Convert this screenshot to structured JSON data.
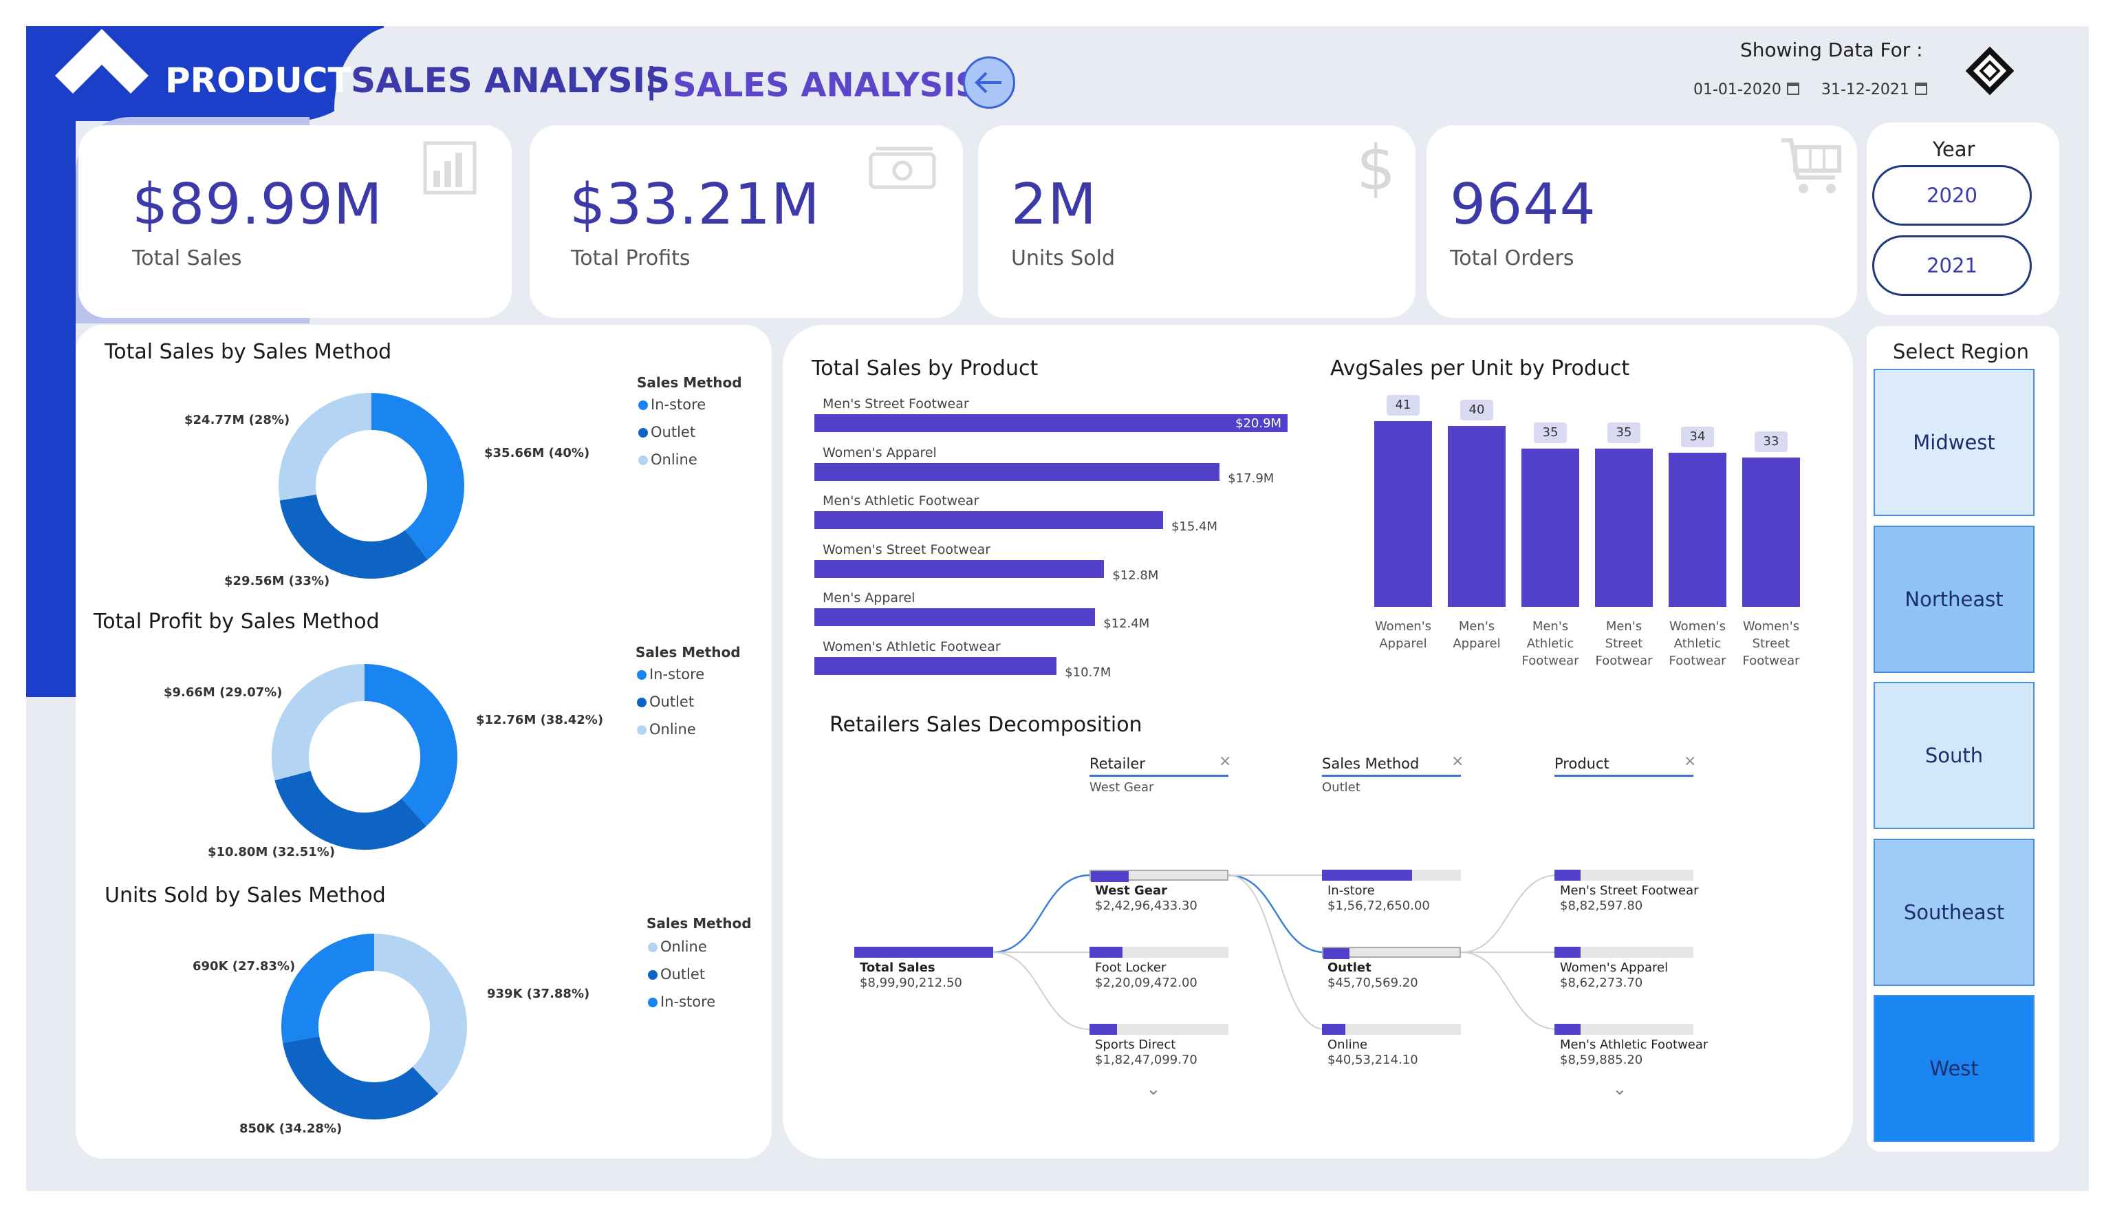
{
  "header": {
    "title_part1": "PRODUCT",
    "title_part2": "SALES ANALYSIS",
    "separator": "|",
    "subtitle": "SALES ANALYSIS",
    "showing_label": "Showing Data For :",
    "date_from": "01-01-2020",
    "date_to": "31-12-2021"
  },
  "kpis": [
    {
      "value": "$89.99M",
      "label": "Total Sales",
      "icon": "bar-chart-icon"
    },
    {
      "value": "$33.21M",
      "label": "Total Profits",
      "icon": "money-icon"
    },
    {
      "value": "2M",
      "label": "Units Sold",
      "icon": "dollar-icon"
    },
    {
      "value": "9644",
      "label": "Total Orders",
      "icon": "cart-icon"
    }
  ],
  "year_slicer": {
    "title": "Year",
    "options": [
      "2020",
      "2021"
    ]
  },
  "region_slicer": {
    "title": "Select Region",
    "regions": [
      {
        "name": "Midwest",
        "color": "#dcecfc"
      },
      {
        "name": "Northeast",
        "color": "#90c4f6"
      },
      {
        "name": "South",
        "color": "#d3e7fb"
      },
      {
        "name": "Southeast",
        "color": "#9fccf7"
      },
      {
        "name": "West",
        "color": "#1b86f2"
      }
    ]
  },
  "colors": {
    "in_store": "#1a85f0",
    "outlet": "#0e64c4",
    "online": "#b4d4f4",
    "bar": "#5340c9",
    "brand": "#1c3fc9"
  },
  "donut_sales": {
    "title": "Total Sales by Sales Method",
    "legend_title": "Sales Method",
    "legend": [
      "In-store",
      "Outlet",
      "Online"
    ],
    "labels": [
      "$35.66M (40%)",
      "$29.56M (33%)",
      "$24.77M (28%)"
    ]
  },
  "donut_profit": {
    "title": "Total Profit by Sales Method",
    "legend_title": "Sales Method",
    "legend": [
      "In-store",
      "Outlet",
      "Online"
    ],
    "labels": [
      "$12.76M (38.42%)",
      "$10.80M (32.51%)",
      "$9.66M (29.07%)"
    ]
  },
  "donut_units": {
    "title": "Units Sold by Sales Method",
    "legend_title": "Sales Method",
    "legend": [
      "Online",
      "Outlet",
      "In-store"
    ],
    "labels": [
      "939K (37.88%)",
      "850K (34.28%)",
      "690K (27.83%)"
    ]
  },
  "chart_data": [
    {
      "type": "pie",
      "title": "Total Sales by Sales Method",
      "categories": [
        "In-store",
        "Outlet",
        "Online"
      ],
      "values": [
        35.66,
        29.56,
        24.77
      ],
      "percent": [
        40,
        33,
        28
      ],
      "unit": "$M"
    },
    {
      "type": "pie",
      "title": "Total Profit by Sales Method",
      "categories": [
        "In-store",
        "Outlet",
        "Online"
      ],
      "values": [
        12.76,
        10.8,
        9.66
      ],
      "percent": [
        38.42,
        32.51,
        29.07
      ],
      "unit": "$M"
    },
    {
      "type": "pie",
      "title": "Units Sold by Sales Method",
      "categories": [
        "Online",
        "Outlet",
        "In-store"
      ],
      "values": [
        939,
        850,
        690
      ],
      "percent": [
        37.88,
        34.28,
        27.83
      ],
      "unit": "K"
    },
    {
      "type": "bar",
      "orientation": "horizontal",
      "title": "Total Sales by Product",
      "categories": [
        "Men's Street Footwear",
        "Women's Apparel",
        "Men's Athletic Footwear",
        "Women's Street Footwear",
        "Men's Apparel",
        "Women's Athletic Footwear"
      ],
      "values": [
        20.9,
        17.9,
        15.4,
        12.8,
        12.4,
        10.7
      ],
      "value_labels": [
        "$20.9M",
        "$17.9M",
        "$15.4M",
        "$12.8M",
        "$12.4M",
        "$10.7M"
      ],
      "unit": "$M"
    },
    {
      "type": "bar",
      "title": "AvgSales per Unit by Product",
      "categories": [
        "Women's Apparel",
        "Men's Apparel",
        "Men's Athletic Footwear",
        "Men's Street Footwear",
        "Women's Athletic Footwear",
        "Women's Street Footwear"
      ],
      "category_lines": [
        [
          "Women's",
          "Apparel"
        ],
        [
          "Men's",
          "Apparel"
        ],
        [
          "Men's",
          "Athletic",
          "Footwear"
        ],
        [
          "Men's",
          "Street",
          "Footwear"
        ],
        [
          "Women's",
          "Athletic",
          "Footwear"
        ],
        [
          "Women's",
          "Street",
          "Footwear"
        ]
      ],
      "values": [
        41,
        40,
        35,
        35,
        34,
        33
      ]
    }
  ],
  "decomposition": {
    "title": "Retailers Sales Decomposition",
    "headers": [
      {
        "name": "Retailer",
        "filter": "West Gear"
      },
      {
        "name": "Sales Method",
        "filter": "Outlet"
      },
      {
        "name": "Product",
        "filter": ""
      }
    ],
    "root": {
      "name": "Total Sales",
      "value": "$8,99,90,212.50",
      "fill": 1.0
    },
    "level1": [
      {
        "name": "West Gear",
        "value": "$2,42,96,433.30",
        "fill": 0.27,
        "selected": true
      },
      {
        "name": "Foot Locker",
        "value": "$2,20,09,472.00",
        "fill": 0.24
      },
      {
        "name": "Sports Direct",
        "value": "$1,82,47,099.70",
        "fill": 0.2
      }
    ],
    "level2": [
      {
        "name": "In-store",
        "value": "$1,56,72,650.00",
        "fill": 0.65
      },
      {
        "name": "Outlet",
        "value": "$45,70,569.20",
        "fill": 0.19,
        "selected": true
      },
      {
        "name": "Online",
        "value": "$40,53,214.10",
        "fill": 0.17
      }
    ],
    "level3": [
      {
        "name": "Men's Street Footwear",
        "value": "$8,82,597.80",
        "fill": 0.19
      },
      {
        "name": "Women's Apparel",
        "value": "$8,62,273.70",
        "fill": 0.19
      },
      {
        "name": "Men's Athletic Footwear",
        "value": "$8,59,885.20",
        "fill": 0.19
      }
    ]
  }
}
